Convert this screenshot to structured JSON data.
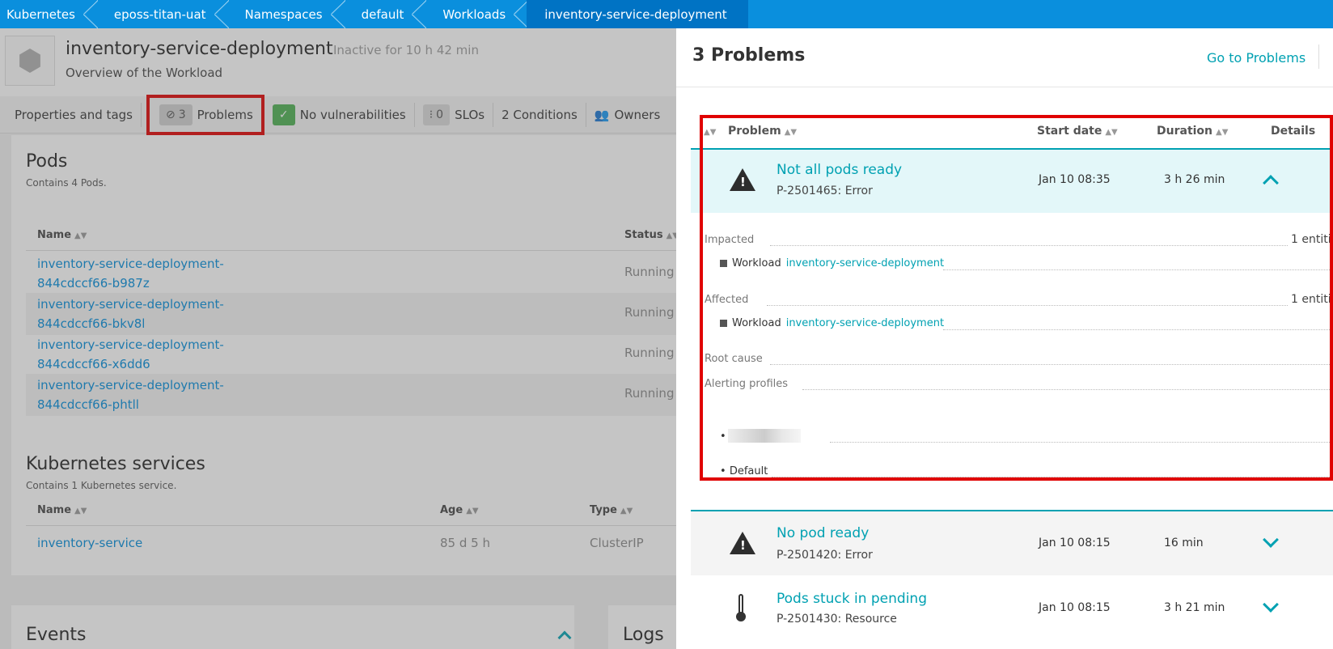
{
  "breadcrumb": [
    "Kubernetes",
    "eposs-titan-uat",
    "Namespaces",
    "default",
    "Workloads",
    "inventory-service-deployment"
  ],
  "workload": {
    "title": "inventory-service-deployment",
    "inactive": "Inactive for 10 h 42 min",
    "subtitle": "Overview of the Workload"
  },
  "tabs": {
    "properties": "Properties and tags",
    "problems_count": "3",
    "problems": "Problems",
    "vulnerabilities": "No vulnerabilities",
    "slo_count": "0",
    "slos": "SLOs",
    "conditions": "2 Conditions",
    "owners": "Owners"
  },
  "pods": {
    "title": "Pods",
    "subtitle": "Contains 4 Pods.",
    "col_name": "Name",
    "col_status": "Status",
    "rows": [
      {
        "name": "inventory-service-deployment-844cdccf66-b987z",
        "status": "Running"
      },
      {
        "name": "inventory-service-deployment-844cdccf66-bkv8l",
        "status": "Running"
      },
      {
        "name": "inventory-service-deployment-844cdccf66-x6dd6",
        "status": "Running"
      },
      {
        "name": "inventory-service-deployment-844cdccf66-phtll",
        "status": "Running"
      }
    ]
  },
  "services": {
    "title": "Kubernetes services",
    "subtitle": "Contains 1 Kubernetes service.",
    "col_name": "Name",
    "col_age": "Age",
    "col_type": "Type",
    "rows": [
      {
        "name": "inventory-service",
        "age": "85 d 5 h",
        "type": "ClusterIP"
      }
    ]
  },
  "events": {
    "title": "Events"
  },
  "logs": {
    "title": "Logs"
  },
  "panel": {
    "title": "3 Problems",
    "go_to": "Go to Problems",
    "cols": {
      "problem": "Problem",
      "start": "Start date",
      "duration": "Duration",
      "details": "Details"
    },
    "problems": [
      {
        "name": "Not all pods ready",
        "id": "P-2501465: Error",
        "start": "Jan 10 08:35",
        "duration": "3 h 26 min"
      },
      {
        "name": "No pod ready",
        "id": "P-2501420: Error",
        "start": "Jan 10 08:15",
        "duration": "16 min"
      },
      {
        "name": "Pods stuck in pending",
        "id": "P-2501430: Resource",
        "start": "Jan 10 08:15",
        "duration": "3 h 21 min"
      }
    ],
    "details": {
      "impacted": "Impacted",
      "impacted_count": "1 entiti",
      "affected": "Affected",
      "affected_count": "1 entiti",
      "entity_type": "Workload",
      "entity_name": "inventory-service-deployment",
      "root_cause": "Root cause",
      "alerting_profiles": "Alerting profiles",
      "profile_default": "Default"
    }
  }
}
